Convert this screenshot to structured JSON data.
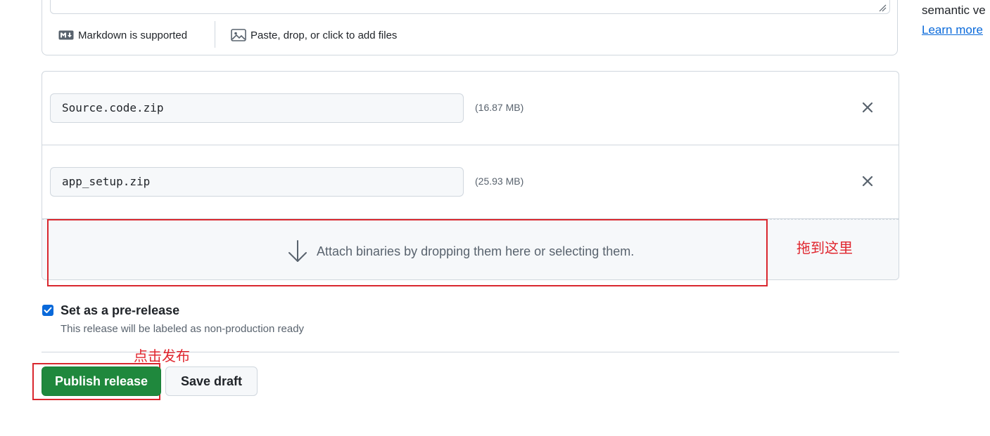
{
  "editor": {
    "markdown_hint": "Markdown is supported",
    "files_hint": "Paste, drop, or click to add files"
  },
  "sidebar": {
    "text": "semantic ve",
    "link": "Learn more"
  },
  "assets": [
    {
      "name": "Source.code.zip",
      "size": "(16.87 MB)"
    },
    {
      "name": "app_setup.zip",
      "size": "(25.93 MB)"
    }
  ],
  "dropzone": {
    "text": "Attach binaries by dropping them here or selecting them."
  },
  "annotations": {
    "drop_note": "拖到这里",
    "publish_note": "点击发布",
    "color": "#e0262e"
  },
  "prerelease": {
    "checked": true,
    "label": "Set as a pre-release",
    "description": "This release will be labeled as non-production ready"
  },
  "buttons": {
    "publish": "Publish release",
    "draft": "Save draft"
  },
  "colors": {
    "primary": "#1f883d",
    "link": "#0969da",
    "checkbox": "#0969da"
  }
}
